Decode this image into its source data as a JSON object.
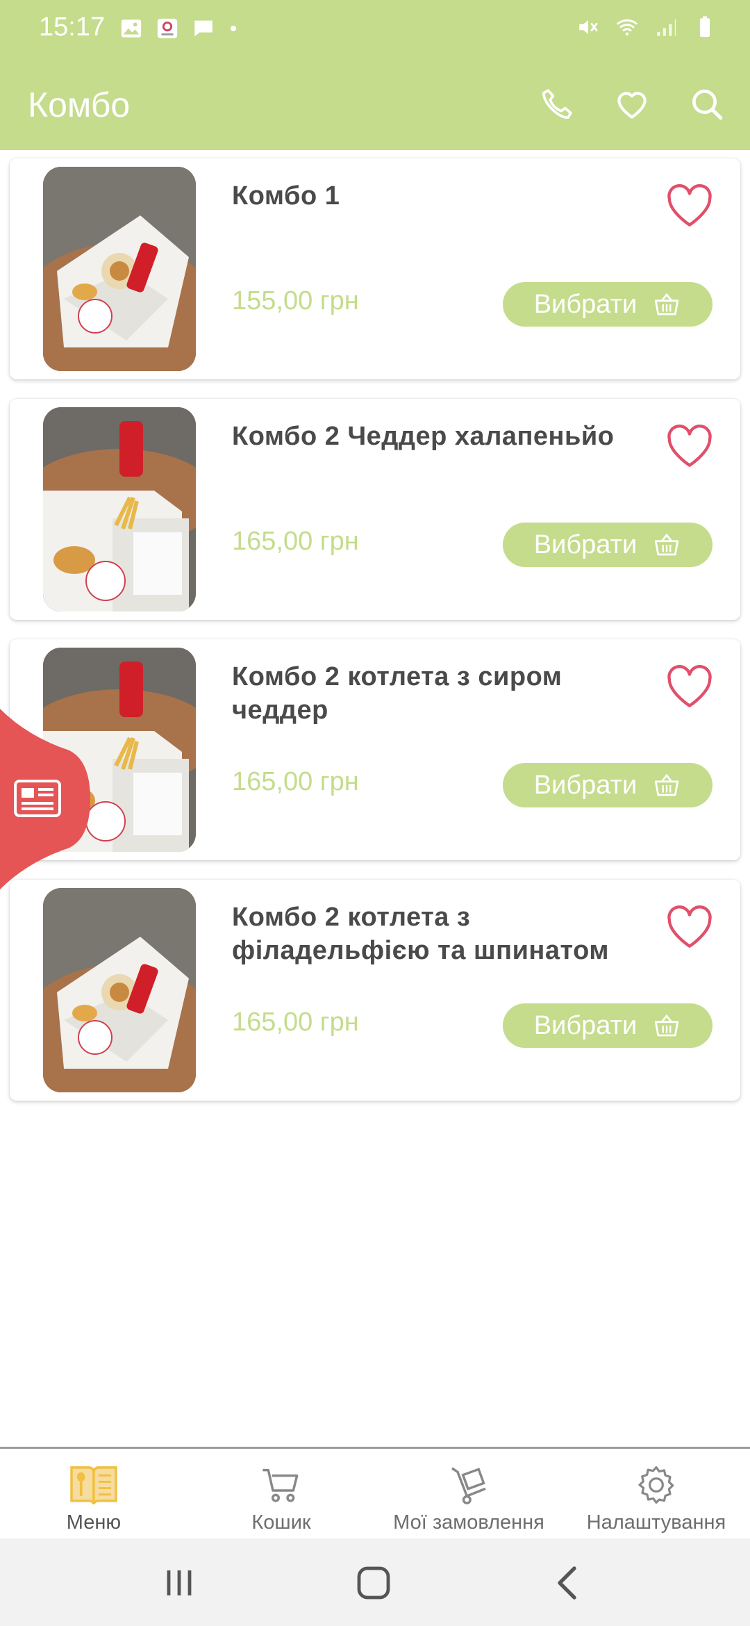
{
  "status_bar": {
    "time": "15:17",
    "left_icons": [
      "image-icon",
      "app-notification-icon",
      "message-icon",
      "dot-icon"
    ],
    "right_icons": [
      "mute-icon",
      "wifi-icon",
      "signal-icon",
      "battery-icon"
    ]
  },
  "app_bar": {
    "title": "Комбо",
    "actions": [
      "phone-icon",
      "heart-icon",
      "search-icon"
    ]
  },
  "colors": {
    "accent": "#c4dc8b",
    "favorite": "#e0506a",
    "catalog_tab": "#e55555",
    "nav_active": "#f0c040",
    "text": "#4a4a4a"
  },
  "products": [
    {
      "name": "Комбо 1",
      "price": "155,00 грн",
      "button": "Вибрати"
    },
    {
      "name": "Комбо 2 Чеддер халапеньйо",
      "price": "165,00 грн",
      "button": "Вибрати"
    },
    {
      "name": "Комбо 2 котлета з сиром чеддер",
      "price": "165,00 грн",
      "button": "Вибрати"
    },
    {
      "name": "Комбо 2 котлета з філадельфією та шпинатом",
      "price": "165,00 грн",
      "button": "Вибрати"
    }
  ],
  "bottom_nav": [
    {
      "label": "Меню",
      "icon": "menu-book-icon",
      "active": true
    },
    {
      "label": "Кошик",
      "icon": "cart-icon",
      "active": false
    },
    {
      "label": "Мої замовлення",
      "icon": "orders-trolley-icon",
      "active": false
    },
    {
      "label": "Налаштування",
      "icon": "gear-icon",
      "active": false
    }
  ],
  "system_nav": [
    "recents-icon",
    "home-icon",
    "back-icon"
  ]
}
